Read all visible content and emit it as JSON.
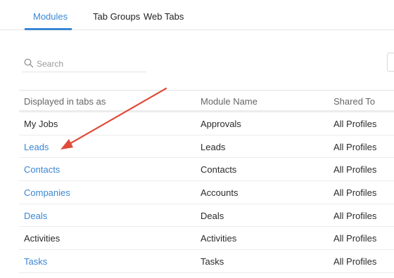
{
  "tabs": [
    {
      "label": "Modules",
      "active": true
    },
    {
      "label": "Tab Groups",
      "active": false
    },
    {
      "label": "Web Tabs",
      "active": false
    }
  ],
  "search": {
    "placeholder": "Search",
    "value": ""
  },
  "table": {
    "headers": [
      "Displayed in tabs as",
      "Module Name",
      "Shared To"
    ],
    "rows": [
      {
        "display": "My Jobs",
        "module": "Approvals",
        "shared": "All Profiles",
        "link": false
      },
      {
        "display": "Leads",
        "module": "Leads",
        "shared": "All Profiles",
        "link": true
      },
      {
        "display": "Contacts",
        "module": "Contacts",
        "shared": "All Profiles",
        "link": true
      },
      {
        "display": "Companies",
        "module": "Accounts",
        "shared": "All Profiles",
        "link": true
      },
      {
        "display": "Deals",
        "module": "Deals",
        "shared": "All Profiles",
        "link": true
      },
      {
        "display": "Activities",
        "module": "Activities",
        "shared": "All Profiles",
        "link": false
      },
      {
        "display": "Tasks",
        "module": "Tasks",
        "shared": "All Profiles",
        "link": true
      }
    ]
  },
  "colors": {
    "accent": "#3a86d4",
    "annotation_arrow": "#e04a3a"
  }
}
